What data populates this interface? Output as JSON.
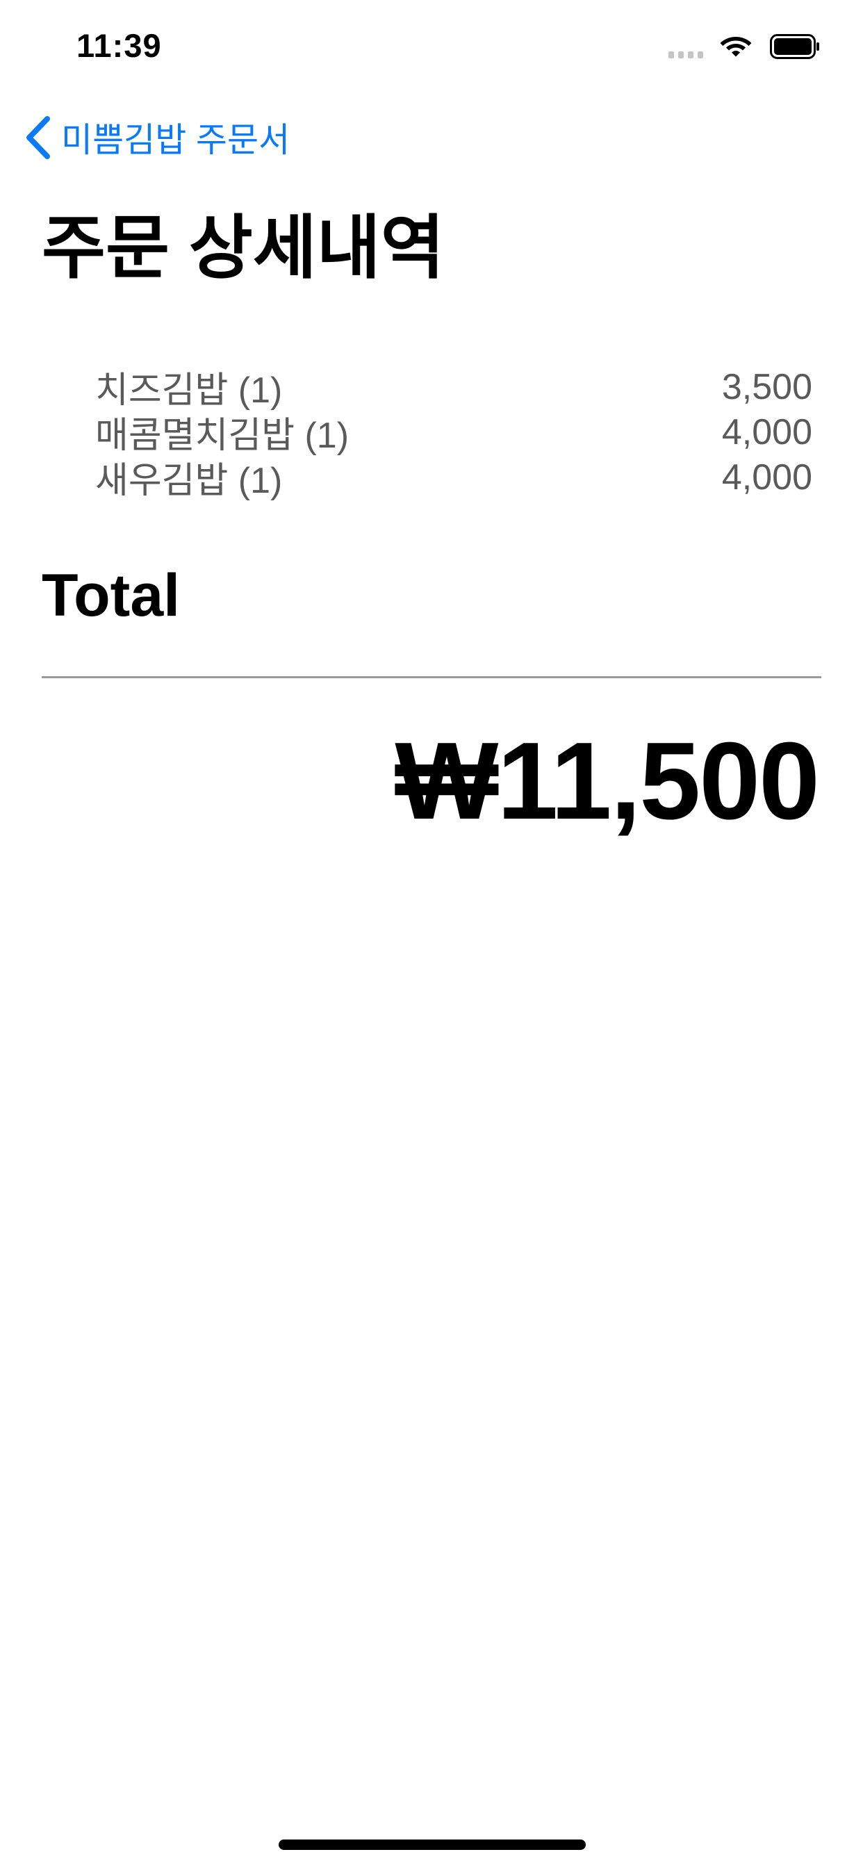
{
  "status_bar": {
    "time": "11:39"
  },
  "nav": {
    "back_label": "미쁨김밥 주문서"
  },
  "page": {
    "title": "주문 상세내역"
  },
  "order": {
    "items": [
      {
        "name": "치즈김밥 (1)",
        "price": "3,500"
      },
      {
        "name": "매콤멸치김밥 (1)",
        "price": "4,000"
      },
      {
        "name": "새우김밥 (1)",
        "price": "4,000"
      }
    ],
    "total_label": "Total",
    "total_amount": "₩11,500"
  },
  "colors": {
    "accent": "#0a7af6",
    "item_text": "#5a5a5a",
    "divider": "#9a9a9a"
  }
}
